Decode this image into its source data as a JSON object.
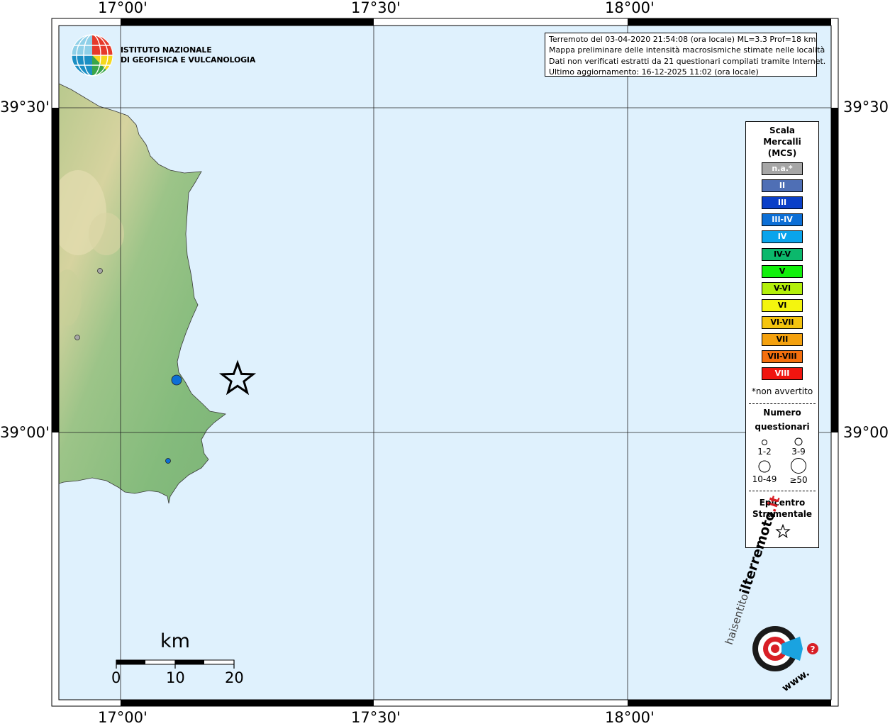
{
  "map": {
    "lon_labels": [
      "17°00'",
      "17°30'",
      "18°00'"
    ],
    "lat_labels": [
      "39°30'",
      "39°00'"
    ],
    "colors": {
      "sea": "#dff1fd",
      "land_low": "#7fb67a",
      "land_high": "#d8d7a0"
    }
  },
  "logo": {
    "line1": "ISTITUTO NAZIONALE",
    "line2": "DI GEOFISICA E VULCANOLOGIA"
  },
  "info": {
    "line1": "Terremoto del 03-04-2020 21:54:08 (ora locale) ML=3.3 Prof=18 km",
    "line2": "Mappa preliminare delle intensità macrosismiche stimate nelle località",
    "line3": "Dati non verificati estratti da 21 questionari compilati tramite Internet.",
    "line4": "Ultimo aggiornamento: 16-12-2025 11:02 (ora locale)"
  },
  "legend": {
    "title1": "Scala",
    "title2": "Mercalli",
    "title3": "(MCS)",
    "scale": [
      {
        "label": "n.a.*",
        "color": "#a6a6a6",
        "text": "#ffffff"
      },
      {
        "label": "II",
        "color": "#4f6fb5",
        "text": "#ffffff"
      },
      {
        "label": "III",
        "color": "#0a3fc8",
        "text": "#ffffff"
      },
      {
        "label": "III-IV",
        "color": "#0c6fd6",
        "text": "#ffffff"
      },
      {
        "label": "IV",
        "color": "#0aa4ec",
        "text": "#ffffff"
      },
      {
        "label": "IV-V",
        "color": "#0bb86c",
        "text": "#000000"
      },
      {
        "label": "V",
        "color": "#11f00c",
        "text": "#000000"
      },
      {
        "label": "V-VI",
        "color": "#b3ef0b",
        "text": "#000000"
      },
      {
        "label": "VI",
        "color": "#f4f50e",
        "text": "#000000"
      },
      {
        "label": "VI-VII",
        "color": "#f4c40e",
        "text": "#000000"
      },
      {
        "label": "VII",
        "color": "#f4a10e",
        "text": "#000000"
      },
      {
        "label": "VII-VIII",
        "color": "#f46f0e",
        "text": "#000000"
      },
      {
        "label": "VIII",
        "color": "#f0150f",
        "text": "#ffffff"
      }
    ],
    "not_felt_note": "*non avvertito",
    "questionnaires_title1": "Numero",
    "questionnaires_title2": "questionari",
    "size_classes": [
      "1-2",
      "3-9",
      "10-49",
      "≥50"
    ],
    "epicenter_title1": "Epicentro",
    "epicenter_title2": "Strumentale"
  },
  "scalebar": {
    "unit": "km",
    "ticks": [
      "0",
      "10",
      "20"
    ]
  },
  "watermark": {
    "text1": "haisentito",
    "text2": "ilterremoto",
    "text3": ".it",
    "text4": "www."
  }
}
